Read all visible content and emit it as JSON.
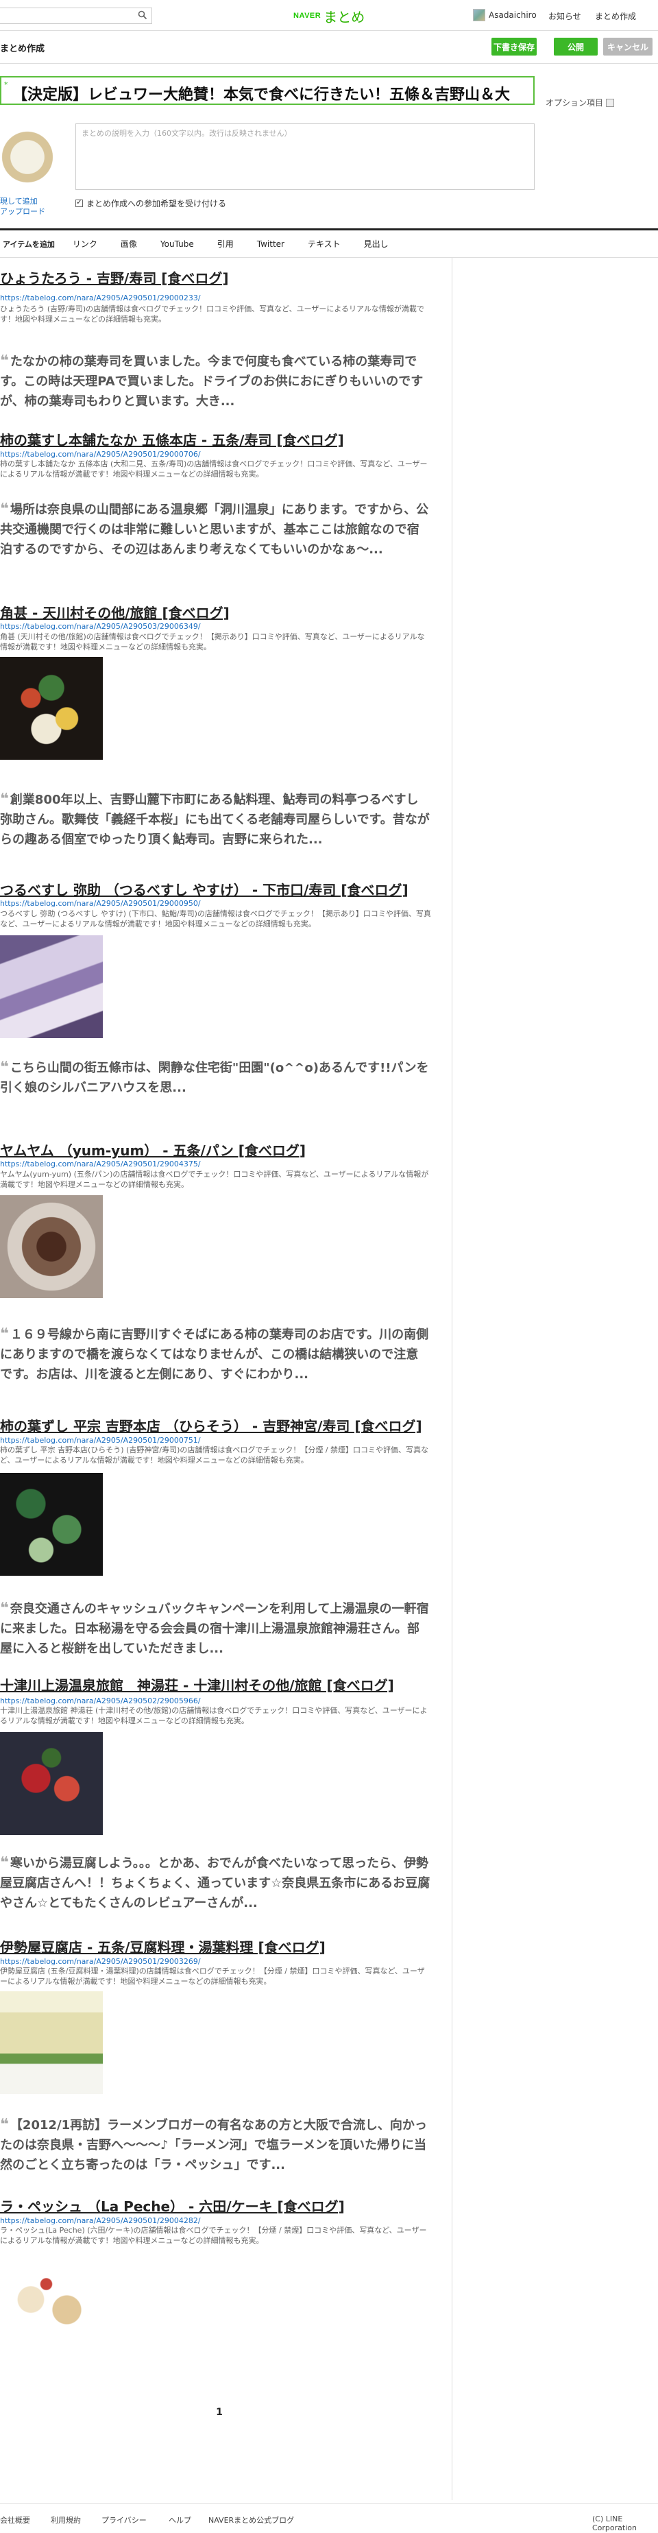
{
  "header": {
    "brand_small": "NAVER",
    "brand_large": "まとめ",
    "username": "Asadaichiro",
    "nav": [
      "お知らせ",
      "まとめ作成"
    ]
  },
  "editor": {
    "title_label": "まとめ作成",
    "buttons": {
      "draft": "下書き保存",
      "publish": "公開",
      "cancel": "キャンセル"
    },
    "required_mark": "*",
    "title_value": "【決定版】レビュワー大絶賛！本気で食べに行きたい！五條＆吉野山＆大",
    "option_link": "オプション項目",
    "thumb_caption_1": "現して追加",
    "thumb_caption_2": "アップロード",
    "desc_placeholder": "まとめの説明を入力（160文字以内。改行は反映されません）",
    "checkbox_label": "まとめ作成への参加希望を受け付ける"
  },
  "item_toolbar": {
    "label": "アイテムを追加",
    "items": [
      "リンク",
      "画像",
      "YouTube",
      "引用",
      "Twitter",
      "テキスト",
      "見出し"
    ]
  },
  "links": [
    {
      "title": "ひょうたろう - 吉野/寿司 [食べログ]",
      "url": "https://tabelog.com/nara/A2905/A290501/29000233/",
      "desc": "ひょうたろう (吉野/寿司)の店舗情報は食べログでチェック！口コミや評価、写真など、ユーザーによるリアルな情報が満載です！地図や料理メニューなどの詳細情報も充実。"
    },
    {
      "title": "柿の葉すし本舗たなか 五條本店 - 五条/寿司 [食べログ]",
      "url": "https://tabelog.com/nara/A2905/A290501/29000706/",
      "desc": "柿の葉すし本舗たなか 五條本店 (大和二見、五条/寿司)の店舗情報は食べログでチェック！口コミや評価、写真など、ユーザーによるリアルな情報が満載です！地図や料理メニューなどの詳細情報も充実。"
    },
    {
      "title": "角甚 - 天川村その他/旅館 [食べログ]",
      "url": "https://tabelog.com/nara/A2905/A290503/29006349/",
      "desc": "角甚 (天川村その他/旅館)の店舗情報は食べログでチェック！【掲示あり】口コミや評価、写真など、ユーザーによるリアルな情報が満載です！地図や料理メニューなどの詳細情報も充実。"
    },
    {
      "title": "つるべすし 弥助 （つるべすし やすけ） - 下市口/寿司 [食べログ]",
      "url": "https://tabelog.com/nara/A2905/A290501/29000950/",
      "desc": "つるべすし 弥助 (つるべすし やすけ) (下市口、鮎鮨/寿司)の店舗情報は食べログでチェック！【掲示あり】口コミや評価、写真など、ユーザーによるリアルな情報が満載です！地図や料理メニューなどの詳細情報も充実。"
    },
    {
      "title": "ヤムヤム （yum-yum） - 五条/パン [食べログ]",
      "url": "https://tabelog.com/nara/A2905/A290501/29004375/",
      "desc": "ヤムヤム(yum-yum) (五条/パン)の店舗情報は食べログでチェック！口コミや評価、写真など、ユーザーによるリアルな情報が満載です！地図や料理メニューなどの詳細情報も充実。"
    },
    {
      "title": "柿の葉ずし 平宗 吉野本店 （ひらそう） - 吉野神宮/寿司 [食べログ]",
      "url": "https://tabelog.com/nara/A2905/A290501/29000751/",
      "desc": "柿の葉ずし 平宗 吉野本店(ひらそう) (吉野神宮/寿司)の店舗情報は食べログでチェック！【分煙 / 禁煙】口コミや評価、写真など、ユーザーによるリアルな情報が満載です！地図や料理メニューなどの詳細情報も充実。"
    },
    {
      "title": "十津川上湯温泉旅館　神湯荘 - 十津川村その他/旅館 [食べログ]",
      "url": "https://tabelog.com/nara/A2905/A290502/29005966/",
      "desc": "十津川上湯温泉旅館 神湯荘 (十津川村その他/旅館)の店舗情報は食べログでチェック！口コミや評価、写真など、ユーザーによるリアルな情報が満載です！地図や料理メニューなどの詳細情報も充実。"
    },
    {
      "title": "伊勢屋豆腐店 - 五条/豆腐料理・湯葉料理 [食べログ]",
      "url": "https://tabelog.com/nara/A2905/A290501/29003269/",
      "desc": "伊勢屋豆腐店 (五条/豆腐料理・湯葉料理)の店舗情報は食べログでチェック！【分煙 / 禁煙】口コミや評価、写真など、ユーザーによるリアルな情報が満載です！地図や料理メニューなどの詳細情報も充実。"
    },
    {
      "title": "ラ・ペッシュ （La Peche） - 六田/ケーキ [食べログ]",
      "url": "https://tabelog.com/nara/A2905/A290501/29004282/",
      "desc": "ラ・ペッシュ(La Peche) (六田/ケーキ)の店舗情報は食べログでチェック！【分煙 / 禁煙】口コミや評価、写真など、ユーザーによるリアルな情報が満載です！地図や料理メニューなどの詳細情報も充実。"
    }
  ],
  "quotes": [
    "たなかの柿の葉寿司を買いました。今まで何度も食べている柿の葉寿司です。この時は天理PAで買いました。ドライブのお供におにぎりもいいのですが、柿の葉寿司もわりと買います。大き...",
    "場所は奈良県の山間部にある温泉郷「洞川温泉」にあります。ですから、公共交通機関で行くのは非常に難しいと思いますが、基本ここは旅館なので宿泊するのですから、その辺はあんまり考えなくてもいいのかなぁ〜...",
    "創業800年以上、吉野山麓下市町にある鮎料理、鮎寿司の料亭つるべすし弥助さん。歌舞伎「義経千本桜」にも出てくる老舗寿司屋らしいです。昔ながらの趣ある個室でゆったり頂く鮎寿司。吉野に来られた...",
    "こちら山間の街五條市は、閑静な住宅街\"田園\"(o^^o)あるんです!!パンを引く娘のシルバニアハウスを思...",
    "１６９号線から南に吉野川すぐそばにある柿の葉寿司のお店です。川の南側にありますので橋を渡らなくてはなりませんが、この橋は結構狭いので注意です。お店は、川を渡ると左側にあり、すぐにわかり...",
    "奈良交通さんのキャッシュバックキャンペーンを利用して上湯温泉の一軒宿に来ました。日本秘湯を守る会会員の宿十津川上湯温泉旅館神湯荘さん。部屋に入ると桜餅を出していただきまし...",
    "寒いから湯豆腐しよう。。。とかあ、おでんが食べたいなって思ったら、伊勢屋豆腐店さんへ！！ちょくちょく、通っています☆奈良県五条市にあるお豆腐やさん☆とてもたくさんのレビュアーさんが...",
    "【2012/1再訪】ラーメンブロガーの有名なあの方と大阪で合流し、向かったのは奈良県・吉野へ〜〜〜♪「ラーメン河」で塩ラーメンを頂いた帰りに当然のごとく立ち寄ったのは「ラ・ペッシュ」です..."
  ],
  "pager": {
    "current": "1"
  },
  "footer": {
    "links": [
      "会社概要",
      "利用規約",
      "プライバシー",
      "ヘルプ",
      "NAVERまとめ公式ブログ"
    ],
    "copyright": "(C) LINE Corporation"
  },
  "colors": {
    "accent": "#3cb828",
    "link": "#1a6ec2",
    "brand": "#2db400"
  }
}
